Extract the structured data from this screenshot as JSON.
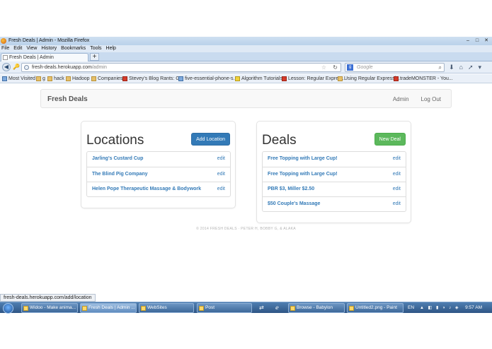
{
  "browser": {
    "window_title": "Fresh Deals | Admin - Mozilla Firefox",
    "menu": [
      "File",
      "Edit",
      "View",
      "History",
      "Bookmarks",
      "Tools",
      "Help"
    ],
    "tab_title": "Fresh Deals | Admin",
    "url_host": "fresh-deals.herokuapp.com",
    "url_path": "/admin",
    "search_placeholder": "Google",
    "bookmarks": [
      "Most Visited",
      "g",
      "hack",
      "Hadoop",
      "Companies",
      "Stevey's Blog Rants: G...",
      "five-essential-phone-s...",
      "Algorithm Tutorials",
      "Lesson: Regular Expres...",
      "Using Regular Expressi...",
      "tradeMONSTER - You..."
    ],
    "status_url": "fresh-deals.herokuapp.com/add/location"
  },
  "site": {
    "brand": "Fresh Deals",
    "nav_admin": "Admin",
    "nav_logout": "Log Out",
    "footer": "© 2014 FRESH DEALS · PETER H, BOBBY G, & ALAKA"
  },
  "locations": {
    "heading": "Locations",
    "button": "Add Location",
    "items": [
      {
        "name": "Jarling's Custard Cup",
        "action": "edit"
      },
      {
        "name": "The Blind Pig Company",
        "action": "edit"
      },
      {
        "name": "Helen Pope Therapeutic Massage & Bodywork",
        "action": "edit"
      }
    ]
  },
  "deals": {
    "heading": "Deals",
    "button": "New Deal",
    "items": [
      {
        "name": "Free Topping with Large Cup!",
        "action": "edit"
      },
      {
        "name": "Free Topping with Large Cup!",
        "action": "edit"
      },
      {
        "name": "PBR $3, Miller $2.50",
        "action": "edit"
      },
      {
        "name": "$50 Couple's Massage",
        "action": "edit"
      }
    ]
  },
  "taskbar": {
    "tasks": [
      "Widoo - Make anima...",
      "Fresh Deals | Admin ...",
      "WebSites",
      "Post",
      "Browse - Babylon",
      "Untitled2.png - Paint"
    ],
    "lang": "EN",
    "clock": "9:57 AM"
  },
  "colors": {
    "primary": "#337ab7",
    "success": "#5cb85c",
    "link": "#337ab7"
  }
}
